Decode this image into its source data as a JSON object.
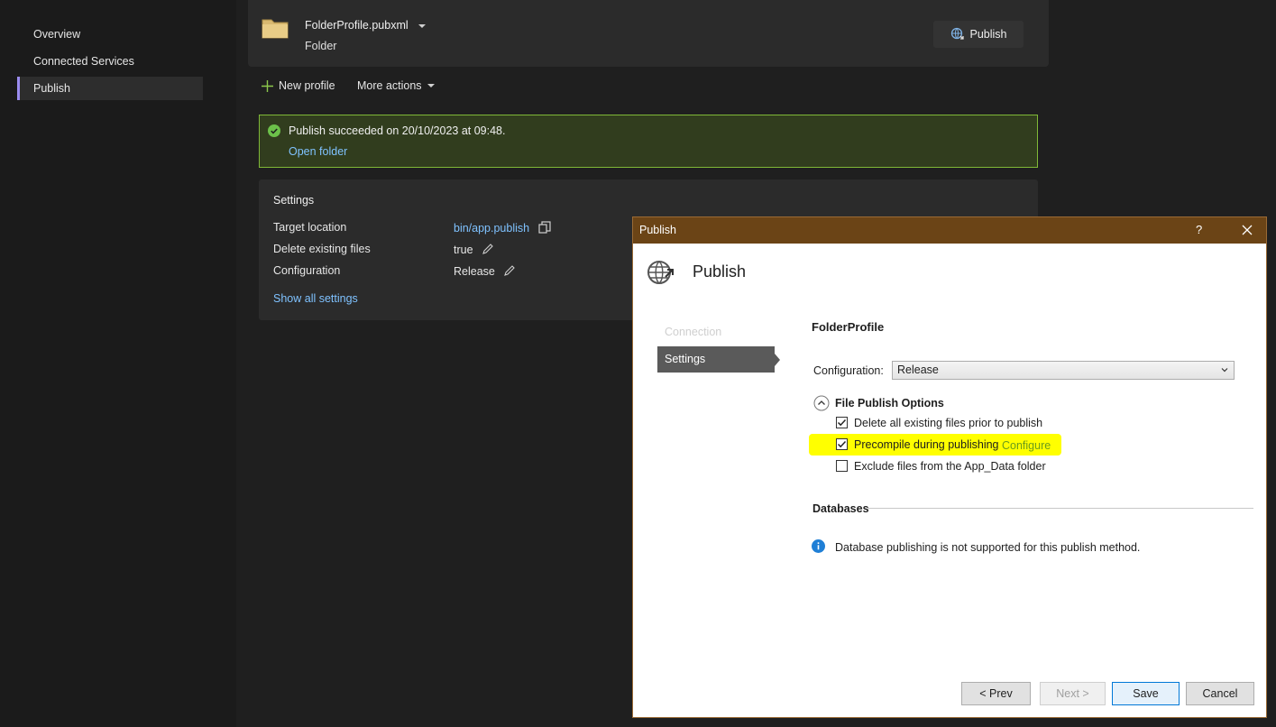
{
  "sidebar": {
    "items": [
      {
        "label": "Overview",
        "active": false
      },
      {
        "label": "Connected Services",
        "active": false
      },
      {
        "label": "Publish",
        "active": true
      }
    ]
  },
  "profile": {
    "name": "FolderProfile.pubxml",
    "type": "Folder",
    "publish_button": "Publish"
  },
  "toolbar": {
    "new_profile": "New profile",
    "more_actions": "More actions"
  },
  "status": {
    "message": "Publish succeeded on 20/10/2023 at 09:48.",
    "open_folder": "Open folder",
    "color": "#7fb837"
  },
  "settings": {
    "title": "Settings",
    "rows": [
      {
        "label": "Target location",
        "value": "bin/app.publish"
      },
      {
        "label": "Delete existing files",
        "value": "true"
      },
      {
        "label": "Configuration",
        "value": "Release"
      }
    ],
    "show_all": "Show all settings"
  },
  "dialog": {
    "title": "Publish",
    "help": "?",
    "header": "Publish",
    "steps": [
      "Connection",
      "Settings"
    ],
    "profile_name": "FolderProfile",
    "configuration_label": "Configuration:",
    "configuration_value": "Release",
    "file_publish_options": "File Publish Options",
    "options": [
      {
        "label": "Delete all existing files prior to publish",
        "checked": true
      },
      {
        "label": "Precompile during publishing",
        "checked": true
      },
      {
        "label": "Exclude files from the App_Data folder",
        "checked": false
      }
    ],
    "configure_link": "Configure",
    "databases_label": "Databases",
    "db_note": "Database publishing is not supported for this publish method.",
    "buttons": {
      "prev": "< Prev",
      "next": "Next >",
      "save": "Save",
      "cancel": "Cancel"
    }
  }
}
